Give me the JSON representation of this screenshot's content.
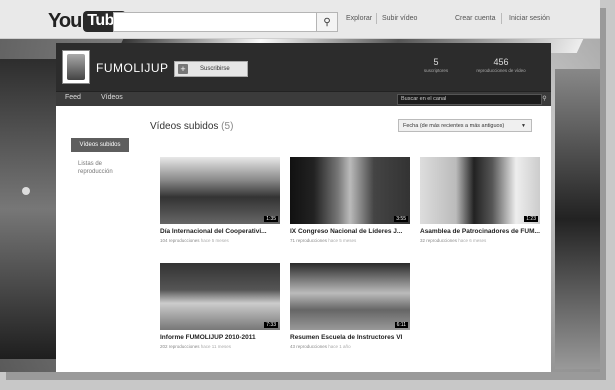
{
  "header": {
    "logo_you": "You",
    "logo_tube": "Tube",
    "search_placeholder": "",
    "links": {
      "explore": "Explorar",
      "upload": "Subir vídeo",
      "create_account": "Crear cuenta",
      "sign_in": "Iniciar sesión"
    }
  },
  "channel": {
    "name": "FUMOLIJUP",
    "subscribe_label": "Suscribirse",
    "stats": [
      {
        "value": "5",
        "label": "suscriptores"
      },
      {
        "value": "456",
        "label": "reproducciones de vídeo"
      }
    ],
    "tabs": [
      "Feed",
      "Vídeos"
    ],
    "search_placeholder": "Buscar en el canal"
  },
  "sidebar": {
    "active": "Vídeos subidos",
    "items": [
      "Listas de reproducción"
    ]
  },
  "main": {
    "title": "Vídeos subidos",
    "count": "(5)",
    "sort_label": "Fecha (de más recientes a más antiguos)"
  },
  "videos": [
    {
      "title": "Día Internacional del Cooperativi...",
      "views": "104 reproducciones",
      "ago": "hace 5 meses",
      "duration": "1:35"
    },
    {
      "title": "IX Congreso Nacional de Líderes J...",
      "views": "71 reproducciones",
      "ago": "hace 5 meses",
      "duration": "3:55"
    },
    {
      "title": "Asamblea de Patrocinadores de FUM...",
      "views": "32 reproducciones",
      "ago": "hace 6 meses",
      "duration": "1:23"
    },
    {
      "title": "Informe FUMOLIJUP 2010-2011",
      "views": "202 reproducciones",
      "ago": "hace 11 meses",
      "duration": "7:33"
    },
    {
      "title": "Resumen Escuela de Instructores VI",
      "views": "43 reproducciones",
      "ago": "hace 1 año",
      "duration": "6:11"
    }
  ]
}
